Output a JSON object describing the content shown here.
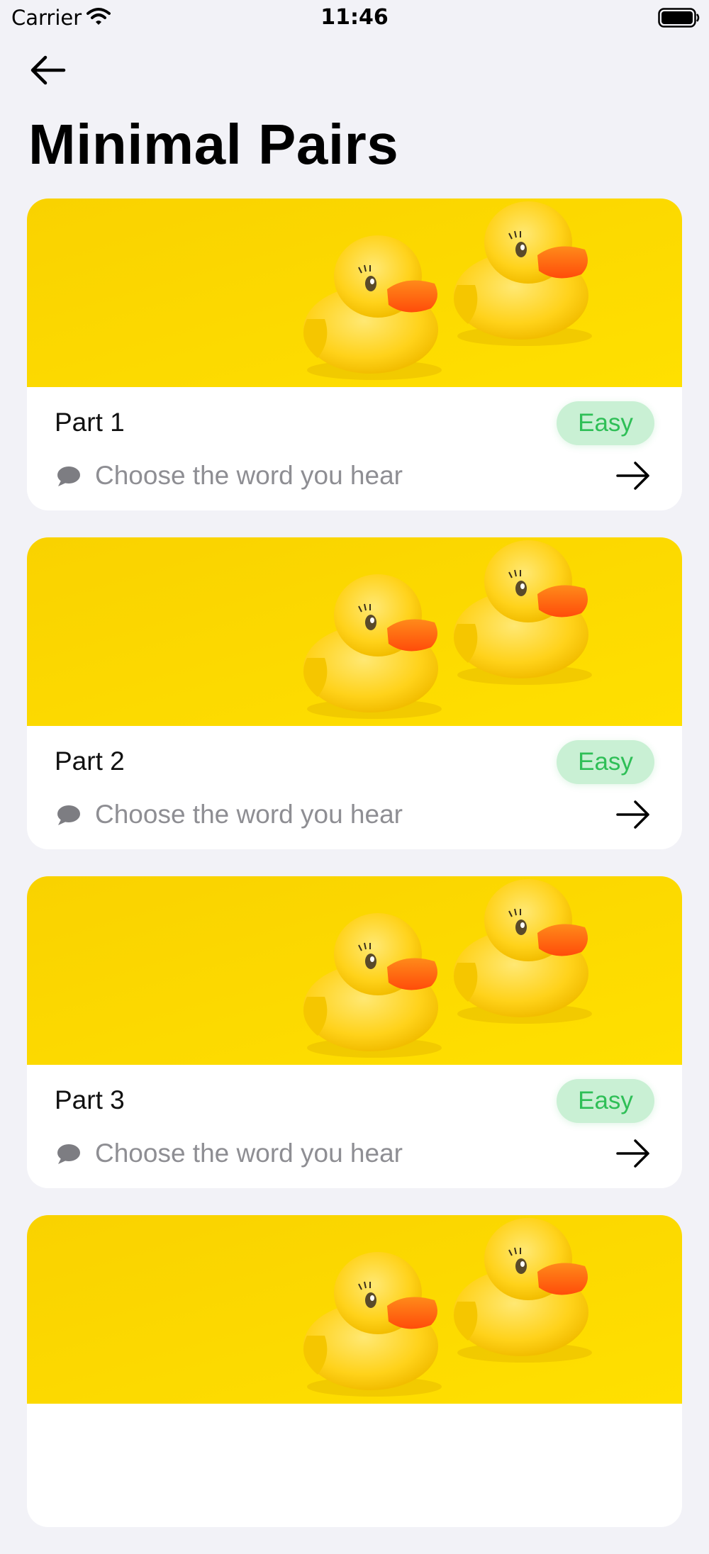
{
  "status_bar": {
    "carrier": "Carrier",
    "time": "11:46"
  },
  "header": {
    "title": "Minimal Pairs",
    "back_icon": "arrow-left-icon"
  },
  "colors": {
    "background": "#f2f2f7",
    "badge_bg": "#c9f0d4",
    "badge_text": "#2fbf57",
    "card_image_yellow": "#fcd400",
    "subtitle_gray": "#8e8e93"
  },
  "cards": [
    {
      "title": "Part 1",
      "difficulty": "Easy",
      "subtitle": "Choose the word you hear",
      "image": "rubber-ducks"
    },
    {
      "title": "Part 2",
      "difficulty": "Easy",
      "subtitle": "Choose the word you hear",
      "image": "rubber-ducks"
    },
    {
      "title": "Part 3",
      "difficulty": "Easy",
      "subtitle": "Choose the word you hear",
      "image": "rubber-ducks"
    }
  ]
}
